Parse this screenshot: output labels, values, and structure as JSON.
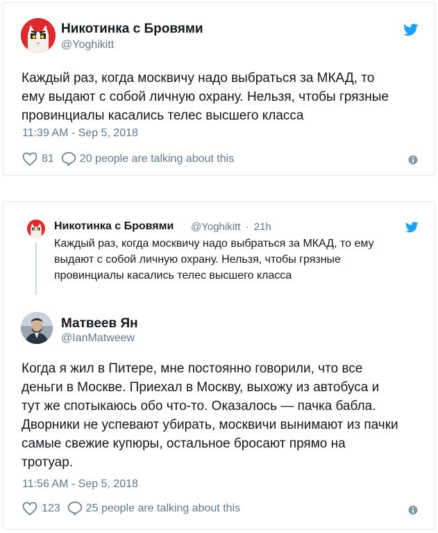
{
  "tweet1": {
    "author_name": "Никотинка с Бровями",
    "author_handle": "@Yoghikitt",
    "text_lines": [
      "Каждый раз, когда москвичу надо выбраться за МКАД, то",
      "ему выдают с собой личную охрану. Нельзя, чтобы грязные",
      "провинциалы касались телес высшего класса"
    ],
    "timestamp": "11:39 AM - Sep 5, 2018",
    "likes": "81",
    "talking": "20 people are talking about this",
    "icons": [
      "twitter-bird-icon",
      "heart-icon",
      "speech-bubble-icon",
      "info-icon"
    ]
  },
  "tweet2": {
    "quoted": {
      "author_name": "Никотинка с Бровями",
      "author_handle": "@Yoghikitt",
      "time_ago": "21h",
      "separator": "·",
      "text_lines": [
        "Каждый раз, когда москвичу надо выбраться за МКАД, то ему",
        "выдают с собой личную охрану. Нельзя, чтобы грязные",
        "провинциалы касались телес высшего класса"
      ]
    },
    "author_name": "Матвеев Ян",
    "author_handle": "@IanMatweew",
    "text_lines": [
      "Когда я жил в Питере, мне постоянно говорили, что все",
      "деньги в Москве. Приехал в Москву, выхожу из автобуса и",
      "тут же спотыкаюсь обо что-то. Оказалось — пачка бабла.",
      "Дворники не успевают убирать, москвичи вынимают из пачки",
      "самые свежие купюры, остальное бросают прямо на",
      "тротуар."
    ],
    "timestamp": "11:56 AM - Sep 5, 2018",
    "likes": "123",
    "talking": "25 people are talking about this"
  },
  "colors": {
    "twitter_blue": "#1da1f2",
    "secondary_text": "#657786",
    "primary_text": "#14171a",
    "border": "#e1e8ed"
  }
}
